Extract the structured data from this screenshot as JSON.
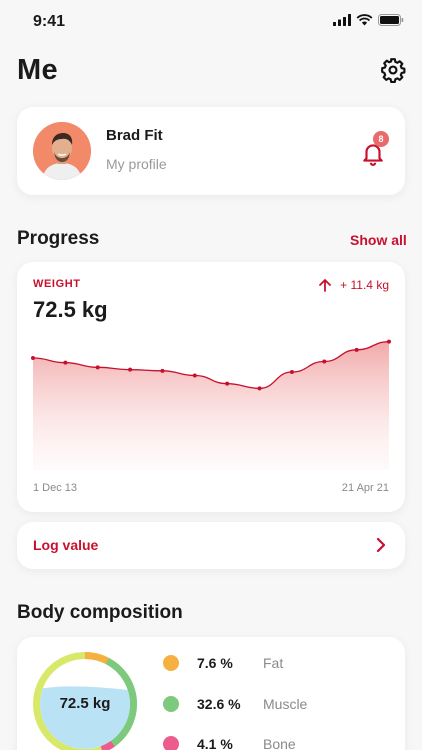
{
  "status_bar": {
    "time": "9:41"
  },
  "header": {
    "title": "Me"
  },
  "profile": {
    "name": "Brad Fit",
    "subtitle": "My profile",
    "notification_count": "8"
  },
  "progress": {
    "section_title": "Progress",
    "show_all_label": "Show all",
    "card": {
      "label": "WEIGHT",
      "value": "72.5 kg",
      "delta": "+ 11.4 kg",
      "x_start_label": "1 Dec 13",
      "x_end_label": "21 Apr 21"
    },
    "log_value_label": "Log value"
  },
  "body_composition": {
    "section_title": "Body composition",
    "total": "72.5 kg",
    "items": [
      {
        "percent": "7.6 %",
        "label": "Fat",
        "color": "#f5b041"
      },
      {
        "percent": "32.6 %",
        "label": "Muscle",
        "color": "#7dc97d"
      },
      {
        "percent": "4.1 %",
        "label": "Bone",
        "color": "#ec5d8e"
      }
    ]
  },
  "colors": {
    "accent": "#c8102e",
    "water": "#b9e2f5",
    "ring": "#d8e96a"
  },
  "chart_data": {
    "type": "area",
    "x": [
      "1 Dec 13",
      "",
      "",
      "",
      "",
      "",
      "",
      "",
      "",
      "",
      "",
      "21 Apr 21"
    ],
    "values": [
      64.6,
      64.2,
      63.8,
      63.6,
      63.5,
      63.1,
      62.4,
      62.0,
      63.4,
      64.3,
      65.3,
      66.0
    ],
    "ylim": [
      55,
      67
    ],
    "grid": false
  }
}
